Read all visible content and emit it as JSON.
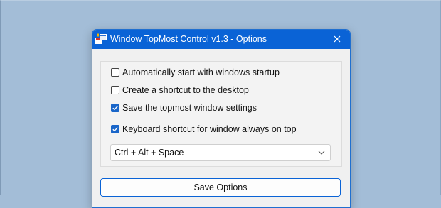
{
  "window": {
    "title": "Window TopMost Control v1.3 - Options",
    "titlebar_color": "#0a63d6",
    "accent_color": "#1a66c9",
    "app_icon": "app-windows-icon",
    "close_icon": "close-icon"
  },
  "options": {
    "items": [
      {
        "label": "Automatically start with windows startup",
        "checked": false
      },
      {
        "label": "Create a shortcut to the desktop",
        "checked": false
      },
      {
        "label": "Save the topmost window settings",
        "checked": true
      },
      {
        "label": "Keyboard shortcut for window always on top",
        "checked": true
      }
    ],
    "shortcut": {
      "value": "Ctrl + Alt + Space",
      "arrow_icon": "chevron-down-icon"
    }
  },
  "actions": {
    "save_label": "Save Options"
  }
}
